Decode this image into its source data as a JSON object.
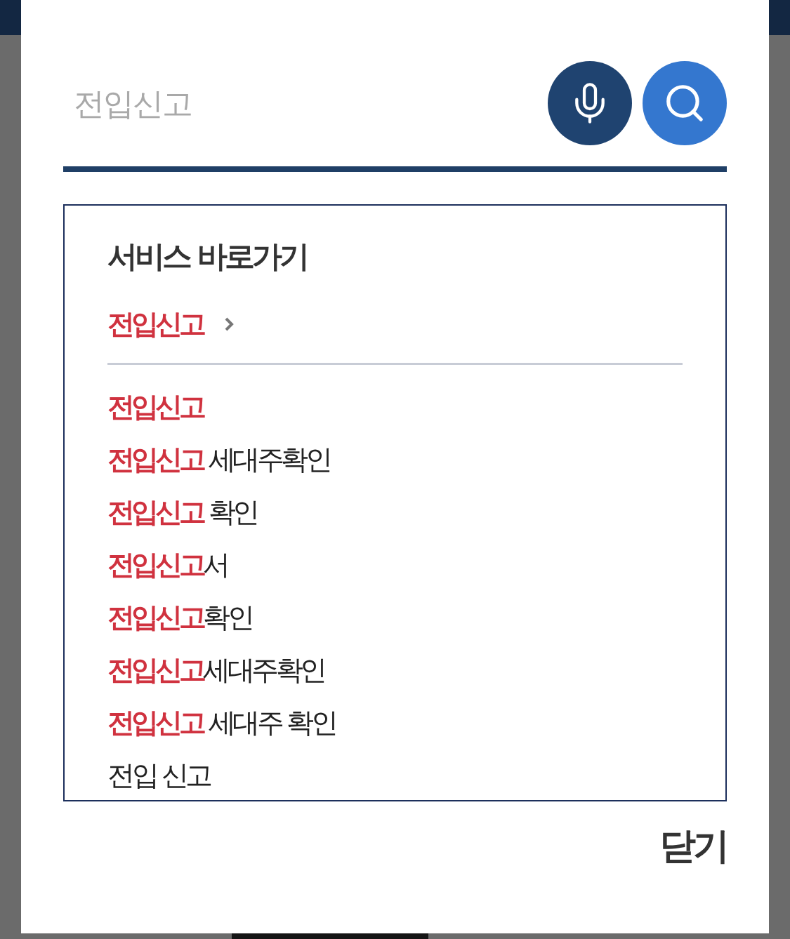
{
  "search": {
    "placeholder": "전입신고"
  },
  "quick_links": {
    "title": "서비스 바로가기",
    "items": [
      {
        "label": "전입신고"
      }
    ]
  },
  "suggestions": [
    {
      "matched": "전입신고"
    },
    {
      "matched": "전입신고",
      "text": " 세대주확인"
    },
    {
      "matched": "전입신고",
      "text": " 확인"
    },
    {
      "matched": "전입신고",
      "text": "서"
    },
    {
      "matched": "전입신고",
      "text": "확인"
    },
    {
      "matched": "전입신고",
      "text": "세대주확인"
    },
    {
      "matched": "전입신고",
      "text": " 세대주 확인"
    },
    {
      "text": "전입 신고"
    }
  ],
  "close_button": {
    "label": "닫기"
  }
}
